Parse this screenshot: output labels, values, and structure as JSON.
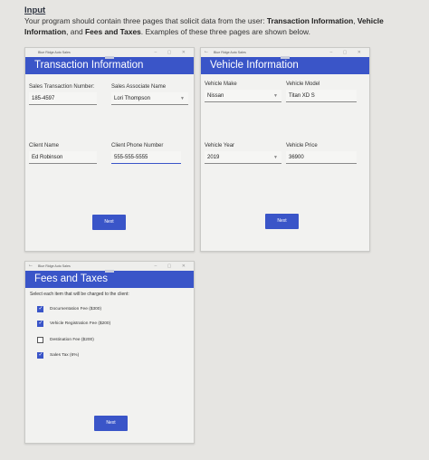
{
  "intro": {
    "heading": "Input",
    "line_pre": "Your program should contain three pages that solicit data from the user: ",
    "bold1": "Transaction Information",
    "mid1": ", ",
    "bold2": "Vehicle Information",
    "mid2": ", and ",
    "bold3": "Fees and Taxes",
    "line_post": ". Examples of these three pages are shown below."
  },
  "transaction_window": {
    "app_title": "Blue Ridge Auto Sales",
    "controls": "– ▢ ✕",
    "banner": "Transaction Information",
    "sales_transaction_number_label": "Sales Transaction Number:",
    "sales_transaction_number_value": "185-4597",
    "sales_associate_name_label": "Sales Associate Name",
    "sales_associate_name_value": "Lori Thompson",
    "client_name_label": "Client Name",
    "client_name_value": "Ed Robinson",
    "client_phone_label": "Client Phone Number",
    "client_phone_value": "555-555-5555",
    "next_label": "Next"
  },
  "vehicle_window": {
    "app_title": "Blue Ridge Auto Sales",
    "back_icon": "arrow-left-icon",
    "controls": "– ▢ ✕",
    "banner": "Vehicle Information",
    "make_label": "Vehicle Make",
    "make_value": "Nissan",
    "model_label": "Vehicle Model",
    "model_value": "Titan XD S",
    "year_label": "Vehicle Year",
    "year_value": "2019",
    "price_label": "Vehicle Price",
    "price_value": "36900",
    "next_label": "Next"
  },
  "fees_window": {
    "app_title": "Blue Ridge Auto Sales",
    "back_icon": "arrow-left-icon",
    "controls": "– ▢ ✕",
    "banner": "Fees and Taxes",
    "instructions": "Select each item that will be charged to the client:",
    "items": [
      {
        "label": "Documentation Fee ($300)",
        "checked": true
      },
      {
        "label": "Vehicle Registration Fee ($200)",
        "checked": true
      },
      {
        "label": "Destination Fee ($200)",
        "checked": false
      },
      {
        "label": "Sales Tax (6%)",
        "checked": true
      }
    ],
    "next_label": "Next"
  },
  "colors": {
    "accent": "#3a55c8",
    "background": "#e6e5e2"
  }
}
